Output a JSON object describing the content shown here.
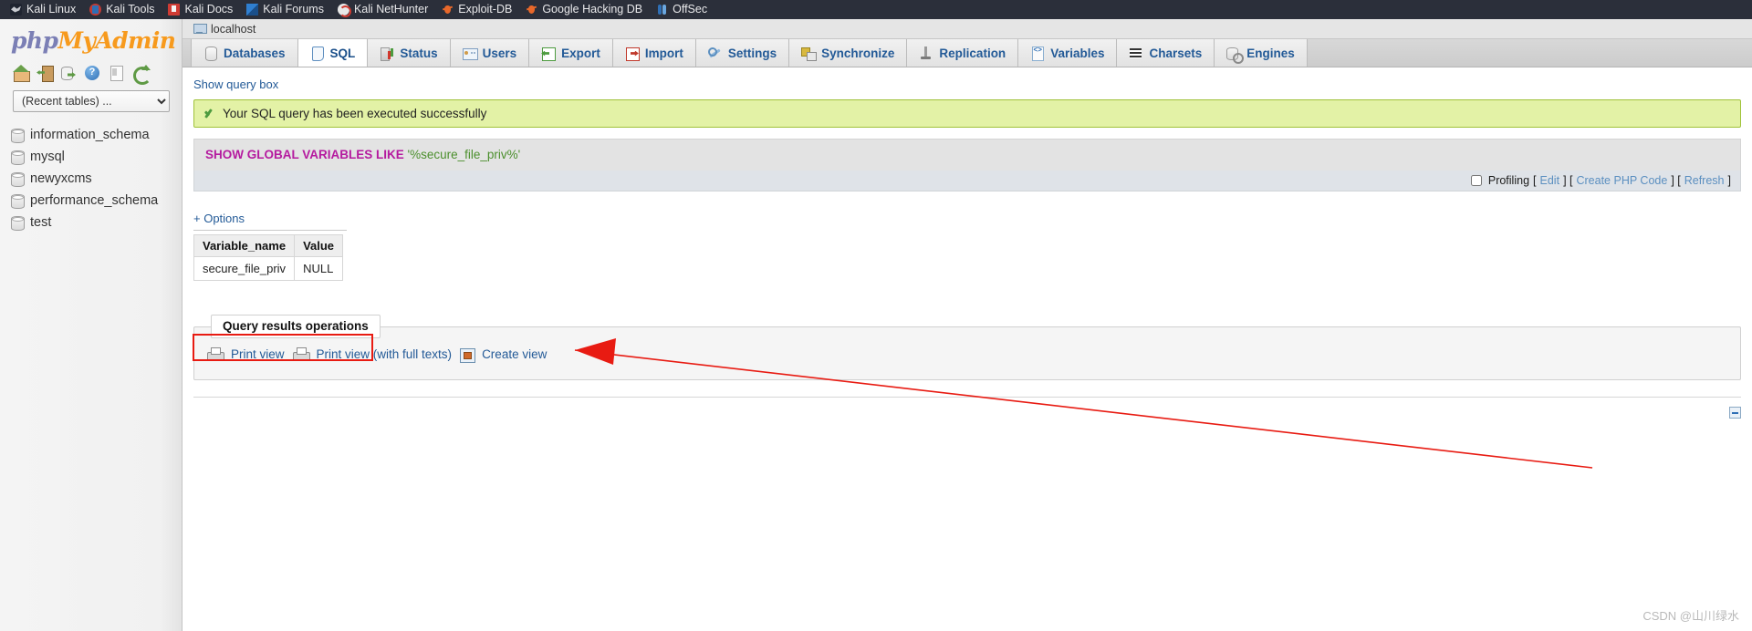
{
  "bookmarks": [
    {
      "label": "Kali Linux",
      "icon": "dragon-icon",
      "cls": "ico-dragon"
    },
    {
      "label": "Kali Tools",
      "icon": "tools-icon",
      "cls": "ico-tools"
    },
    {
      "label": "Kali Docs",
      "icon": "docs-icon",
      "cls": "ico-docs"
    },
    {
      "label": "Kali Forums",
      "icon": "forums-icon",
      "cls": "ico-forums"
    },
    {
      "label": "Kali NetHunter",
      "icon": "nethunter-icon",
      "cls": "ico-nethunter"
    },
    {
      "label": "Exploit-DB",
      "icon": "bug-icon",
      "cls": "ico-bug"
    },
    {
      "label": "Google Hacking DB",
      "icon": "bug-icon",
      "cls": "ico-bug"
    },
    {
      "label": "OffSec",
      "icon": "offsec-icon",
      "cls": "ico-offsec"
    }
  ],
  "sidebar": {
    "logo_php": "php",
    "logo_my": "MyAdmin",
    "icons": [
      {
        "name": "home-icon",
        "cls": "navico-home"
      },
      {
        "name": "logout-icon",
        "cls": "navico-exit"
      },
      {
        "name": "database-exit-icon",
        "cls": "navico-db"
      },
      {
        "name": "help-icon",
        "cls": "navico-help"
      },
      {
        "name": "documentation-icon",
        "cls": "navico-doc"
      },
      {
        "name": "reload-icon",
        "cls": "navico-refresh"
      }
    ],
    "recent_tables_selected": "(Recent tables) ...",
    "databases": [
      "information_schema",
      "mysql",
      "newyxcms",
      "performance_schema",
      "test"
    ]
  },
  "server": {
    "label": "localhost"
  },
  "tabs": [
    {
      "label": "Databases",
      "icon": "database-icon",
      "cls": "tico-db",
      "active": false
    },
    {
      "label": "SQL",
      "icon": "sql-icon",
      "cls": "tico-sql",
      "active": true
    },
    {
      "label": "Status",
      "icon": "status-icon",
      "cls": "tico-status",
      "active": false
    },
    {
      "label": "Users",
      "icon": "users-icon",
      "cls": "tico-users",
      "active": false
    },
    {
      "label": "Export",
      "icon": "export-icon",
      "cls": "tico-export",
      "active": false
    },
    {
      "label": "Import",
      "icon": "import-icon",
      "cls": "tico-import",
      "active": false
    },
    {
      "label": "Settings",
      "icon": "wrench-icon",
      "cls": "tico-settings",
      "active": false
    },
    {
      "label": "Synchronize",
      "icon": "synchronize-icon",
      "cls": "tico-sync",
      "active": false
    },
    {
      "label": "Replication",
      "icon": "replication-icon",
      "cls": "tico-repl",
      "active": false
    },
    {
      "label": "Variables",
      "icon": "variables-icon",
      "cls": "tico-vars",
      "active": false
    },
    {
      "label": "Charsets",
      "icon": "charsets-icon",
      "cls": "tico-charsets",
      "active": false
    },
    {
      "label": "Engines",
      "icon": "engines-icon",
      "cls": "tico-engines",
      "active": false
    }
  ],
  "content": {
    "show_query_box": "Show query box",
    "success_message": "Your SQL query has been executed successfully",
    "sql_keyword": "SHOW GLOBAL VARIABLES LIKE",
    "sql_literal": "'%secure_file_priv%'",
    "profiling_label": "Profiling",
    "profiling_open": "[",
    "profiling_edit": "Edit",
    "profiling_sep1": "] [",
    "profiling_create_php": "Create PHP Code",
    "profiling_sep2": "] [",
    "profiling_refresh": "Refresh",
    "profiling_close": "]",
    "options_link": "+ Options"
  },
  "results": {
    "columns": [
      "Variable_name",
      "Value"
    ],
    "rows": [
      [
        "secure_file_priv",
        "NULL"
      ]
    ]
  },
  "query_results_operations": {
    "legend": "Query results operations",
    "print_view": "Print view",
    "print_view_full": "Print view (with full texts)",
    "create_view": "Create view"
  },
  "watermark": "CSDN @山川绿水",
  "colors": {
    "accent_blue": "#235a97",
    "success_bg": "#e3f2a6",
    "keyword_magenta": "#b51a9f",
    "string_green": "#4b8f2c",
    "highlight_red": "#e81b12"
  }
}
